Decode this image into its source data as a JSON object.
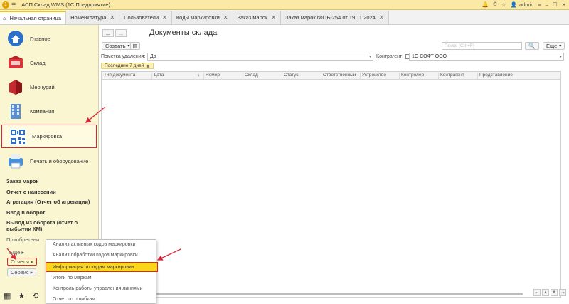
{
  "titlebar": {
    "app_title": "АСП.Склад.WMS  (1С:Предприятие)",
    "user": "admin"
  },
  "tabs": [
    {
      "label": "Начальная страница",
      "home": true
    },
    {
      "label": "Номенклатура"
    },
    {
      "label": "Пользователи"
    },
    {
      "label": "Коды маркировки"
    },
    {
      "label": "Заказ марок"
    },
    {
      "label": "Заказ марок №ЦБ-254 от 19.11.2024"
    }
  ],
  "sidebar": {
    "sections": [
      {
        "label": "Главное",
        "icon": "home-icon"
      },
      {
        "label": "Склад",
        "icon": "warehouse-icon"
      },
      {
        "label": "Мерчурий",
        "icon": "mercury-icon"
      },
      {
        "label": "Компания",
        "icon": "company-building-icon"
      },
      {
        "label": "Маркировка",
        "icon": "qr-code-icon"
      },
      {
        "label": "Печать и оборудование",
        "icon": "printer-icon"
      }
    ],
    "items": [
      "Заказ марок",
      "Отчет о нанесении",
      "Агрегация (Отчет об агрегации)",
      "Ввод в оборот",
      "Вывод из оборота (отчет о выбытии КМ)",
      "Приобретени..."
    ],
    "more_label": "Ещё",
    "reports_label": "Отчеты",
    "service_label": "Сервис"
  },
  "main": {
    "title": "Документы склада",
    "create_label": "Создать",
    "search_placeholder": "Поиск (Ctrl+F)",
    "more_label": "Еще",
    "filter_deletion_label": "Пометка удаления:",
    "filter_deletion_value": "Да",
    "filter_contractor_label": "Контрагент:",
    "filter_contractor_value": "1С-СОФТ ООО",
    "period_tag": "Последние 7 дней",
    "columns": [
      "Тип документа",
      "Дата",
      "Номер",
      "Склад",
      "Статус",
      "Ответственный",
      "Устройство",
      "Контролер",
      "Контрагент",
      "Представление"
    ]
  },
  "popup": {
    "items": [
      "Анализ активных кодов маркировки",
      "Анализ обработки кодов маркировки",
      "Информация по кодам маркировки",
      "Итоги по маркам",
      "Контроль работы управления линиями",
      "Отчет по ошибкам"
    ],
    "highlighted_index": 2
  },
  "colors": {
    "accent_yellow": "#fbd51a",
    "sidebar_bg": "#fbf6d2",
    "annotation_red": "#d7263b"
  }
}
